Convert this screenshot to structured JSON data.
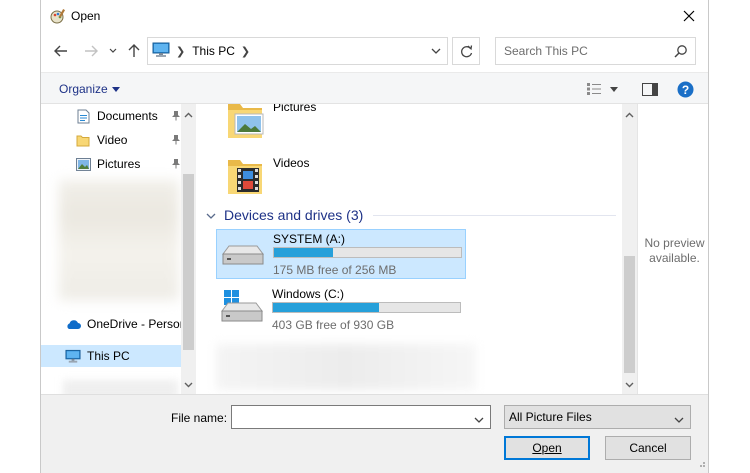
{
  "window": {
    "title": "Open",
    "title_icon": "open-dialog-icon"
  },
  "nav": {
    "back_icon": "arrow-left-icon",
    "forward_icon": "arrow-right-icon",
    "recent_icon": "chevron-down-icon",
    "up_icon": "arrow-up-icon",
    "address": {
      "root_icon": "this-pc-icon",
      "crumb": "This PC"
    },
    "search_placeholder": "Search This PC"
  },
  "command_bar": {
    "organize_label": "Organize"
  },
  "nav_pane": {
    "items": [
      {
        "label": "Documents",
        "icon": "documents-icon",
        "pinned": true
      },
      {
        "label": "Video",
        "icon": "folder-icon",
        "pinned": true
      },
      {
        "label": "Pictures",
        "icon": "pictures-icon",
        "pinned": true
      },
      {
        "label": "OneDrive - Person",
        "icon": "onedrive-icon",
        "pinned": false
      },
      {
        "label": "This PC",
        "icon": "this-pc-icon",
        "pinned": false,
        "selected": true
      }
    ]
  },
  "content": {
    "folders": [
      {
        "label": "Pictures",
        "icon": "pictures-folder-icon"
      },
      {
        "label": "Videos",
        "icon": "videos-folder-icon"
      }
    ],
    "group_header": "Devices and drives (3)",
    "drives": [
      {
        "name": "SYSTEM (A:)",
        "free_text": "175 MB free of 256 MB",
        "used_fraction": 0.316,
        "selected": true,
        "icon": "drive-icon"
      },
      {
        "name": "Windows (C:)",
        "free_text": "403 GB free of 930 GB",
        "used_fraction": 0.567,
        "selected": false,
        "icon": "windows-drive-icon"
      }
    ]
  },
  "preview": {
    "line1": "No preview",
    "line2": "available."
  },
  "footer": {
    "file_name_label": "File name:",
    "file_name_value": "",
    "file_type_selected": "All Picture Files",
    "open_label": "Open",
    "cancel_label": "Cancel"
  },
  "colors": {
    "accent": "#0078d7",
    "selection": "#cce8ff",
    "progress": "#26a0da",
    "link": "#1e3287"
  }
}
